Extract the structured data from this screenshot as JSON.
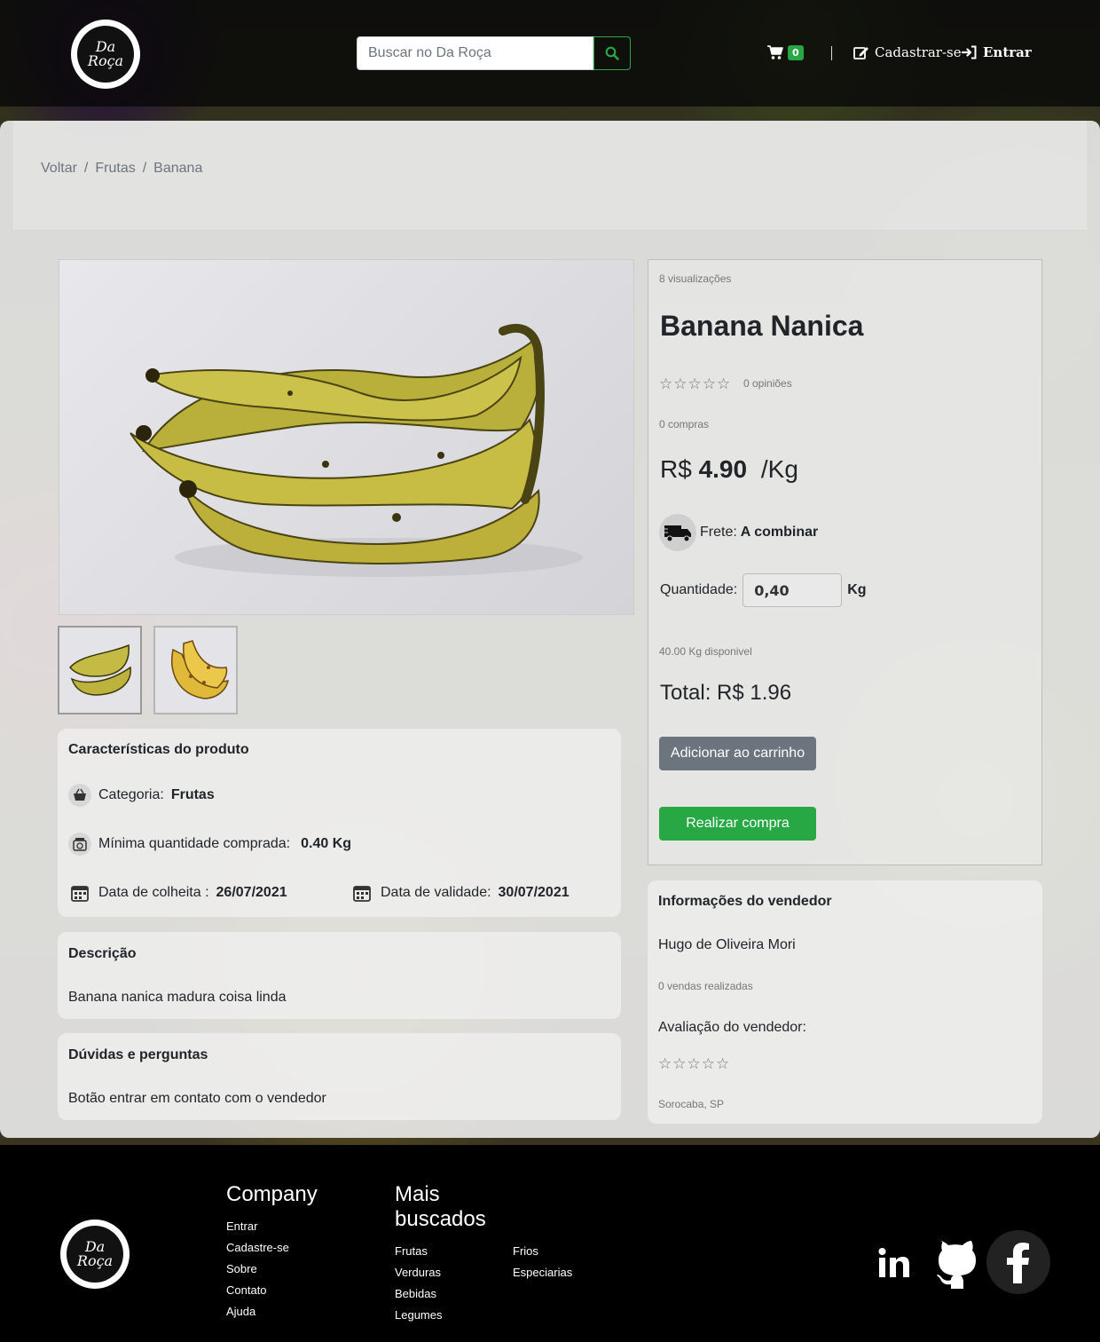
{
  "brand": {
    "line1": "Da",
    "line2": "Roça"
  },
  "header": {
    "search_placeholder": "Buscar no Da Roça",
    "cart_count": "0",
    "signup_label": "Cadastrar-se",
    "login_label": "Entrar"
  },
  "breadcrumb": {
    "items": [
      "Voltar",
      "Frutas",
      "Banana"
    ],
    "separator": "/"
  },
  "characteristics": {
    "title": "Características do produto",
    "category_label": "Categoria:",
    "category_value": "Frutas",
    "min_qty_label": "Mínima quantidade comprada:",
    "min_qty_value": "0.40 Kg",
    "harvest_label": "Data de colheita :",
    "harvest_value": "26/07/2021",
    "expiry_label": "Data de validade:",
    "expiry_value": "30/07/2021"
  },
  "description": {
    "title": "Descrição",
    "text": "Banana nanica madura coisa linda"
  },
  "faq": {
    "title": "Dúvidas e perguntas",
    "text": "Botão entrar em contato com o vendedor"
  },
  "product": {
    "views": "8 visualizações",
    "name": "Banana Nanica",
    "rating_stars": 0,
    "reviews": "0 opiniões",
    "purchases": "0 compras",
    "currency": "R$",
    "price": "4.90",
    "unit": "/Kg",
    "shipping_label": "Frete:",
    "shipping_value": "A combinar",
    "quantity_label": "Quantidade:",
    "quantity_value": "0,40",
    "quantity_unit": "Kg",
    "available": "40.00 Kg disponivel",
    "total": "Total: R$ 1.96",
    "add_to_cart": "Adicionar ao carrinho",
    "buy_now": "Realizar compra"
  },
  "seller": {
    "title": "Informações do vendedor",
    "name": "Hugo de Oliveira Mori",
    "sales": "0 vendas realizadas",
    "rating_label": "Avaliação do vendedor:",
    "rating_stars": 0,
    "location": "Sorocaba, SP"
  },
  "footer": {
    "company_title": "Company",
    "company_links": [
      "Entrar",
      "Cadastre-se",
      "Sobre",
      "Contato",
      "Ajuda"
    ],
    "popular_title_1": "Mais",
    "popular_title_2": "buscados",
    "popular_col1": [
      "Frutas",
      "Verduras",
      "Bebidas",
      "Legumes"
    ],
    "popular_col2": [
      "Frios",
      "Especiarias"
    ],
    "social": [
      "linkedin-icon",
      "github-icon",
      "facebook-icon"
    ]
  },
  "colors": {
    "accent": "#28a745",
    "secondary_button": "#6c757d",
    "header_bg": "#080808"
  }
}
